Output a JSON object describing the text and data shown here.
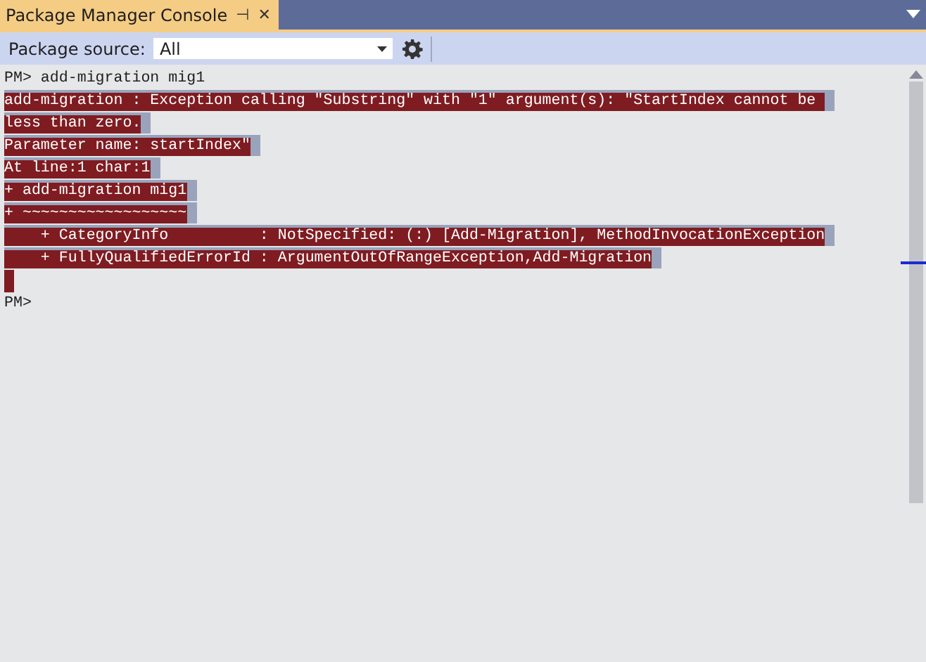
{
  "tab": {
    "title": "Package Manager Console",
    "pin_glyph": "⊣",
    "close_glyph": "✕"
  },
  "toolbar": {
    "label": "Package source:",
    "source": "All"
  },
  "console": [
    {
      "kind": "prompt",
      "text": "PM> add-migration mig1"
    },
    {
      "kind": "error",
      "text": "add-migration : Exception calling \"Substring\" with \"1\" argument(s): \"StartIndex cannot be "
    },
    {
      "kind": "error",
      "text": "less than zero."
    },
    {
      "kind": "error",
      "text": "Parameter name: startIndex\""
    },
    {
      "kind": "error",
      "text": "At line:1 char:1"
    },
    {
      "kind": "error",
      "text": "+ add-migration mig1"
    },
    {
      "kind": "error",
      "text": "+ ~~~~~~~~~~~~~~~~~~"
    },
    {
      "kind": "error",
      "text": "    + CategoryInfo          : NotSpecified: (:) [Add-Migration], MethodInvocationException"
    },
    {
      "kind": "error",
      "text": "    + FullyQualifiedErrorId : ArgumentOutOfRangeException,Add-Migration"
    },
    {
      "kind": "error-blank"
    },
    {
      "kind": "prompt",
      "text": "PM>"
    }
  ]
}
